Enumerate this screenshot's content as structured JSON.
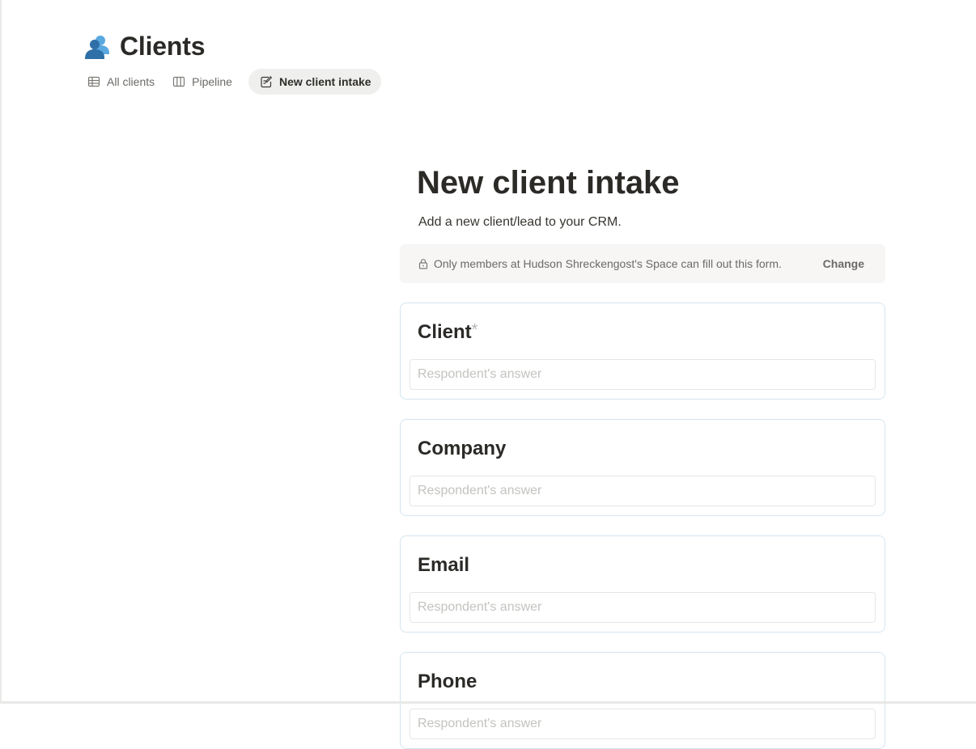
{
  "page": {
    "title": "Clients",
    "icon": "people-icon"
  },
  "tabs": [
    {
      "label": "All clients",
      "icon": "table-icon",
      "active": false
    },
    {
      "label": "Pipeline",
      "icon": "board-icon",
      "active": false
    },
    {
      "label": "New client intake",
      "icon": "form-icon",
      "active": true
    }
  ],
  "form": {
    "title": "New client intake",
    "description": "Add a new client/lead to your CRM.",
    "permission": {
      "text": "Only members at Hudson Shreckengost's Space can fill out this form.",
      "action": "Change",
      "icon": "lock-icon"
    },
    "questions": [
      {
        "label": "Client",
        "required": true,
        "required_mark": "*",
        "placeholder": "Respondent's answer",
        "value": ""
      },
      {
        "label": "Company",
        "required": false,
        "required_mark": "",
        "placeholder": "Respondent's answer",
        "value": ""
      },
      {
        "label": "Email",
        "required": false,
        "required_mark": "",
        "placeholder": "Respondent's answer",
        "value": ""
      },
      {
        "label": "Phone",
        "required": false,
        "required_mark": "",
        "placeholder": "Respondent's answer",
        "value": ""
      }
    ]
  },
  "colors": {
    "accent_icon_dark": "#2f6fa7",
    "accent_icon_light": "#59a8e0",
    "card_border": "#d3e5ef",
    "active_tab_bg": "#efefee"
  }
}
